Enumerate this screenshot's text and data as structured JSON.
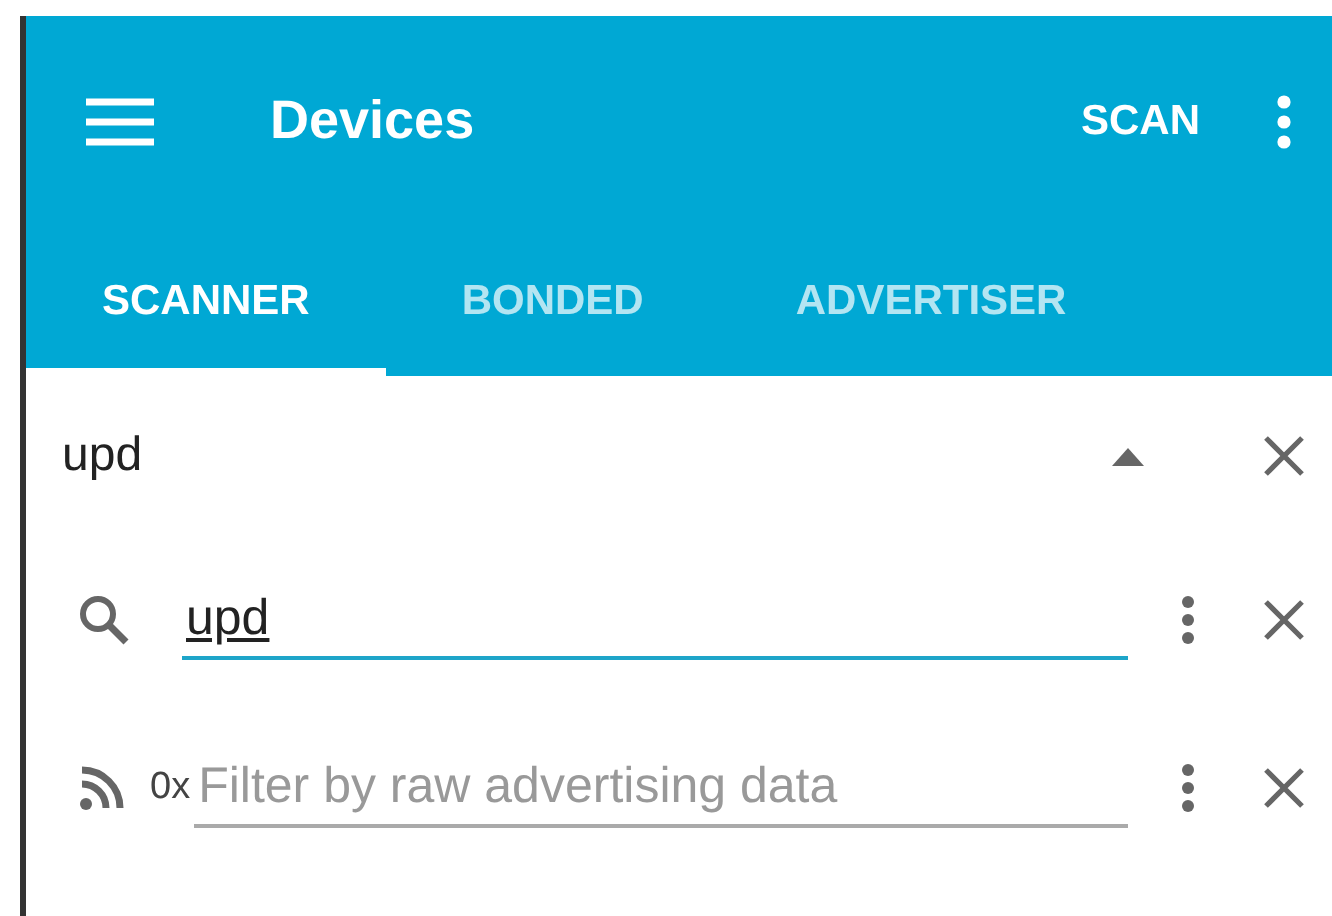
{
  "app_bar": {
    "title": "Devices",
    "action": "SCAN"
  },
  "tabs": [
    {
      "label": "SCANNER",
      "selected": true
    },
    {
      "label": "BONDED",
      "selected": false
    },
    {
      "label": "ADVERTISER",
      "selected": false
    }
  ],
  "filter_header": {
    "text": "upd",
    "expanded": true
  },
  "filters": [
    {
      "kind": "name",
      "value": "upd"
    },
    {
      "kind": "raw",
      "prefix": "0x",
      "placeholder": "Filter by raw advertising data"
    }
  ]
}
